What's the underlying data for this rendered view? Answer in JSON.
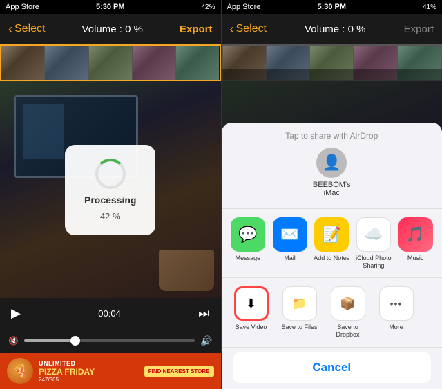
{
  "left_panel": {
    "status_bar": {
      "carrier": "App Store",
      "signal": "●●●●",
      "wifi": "wifi",
      "time": "5:30 PM",
      "battery": "42%"
    },
    "nav": {
      "back_label": "Select",
      "title": "Volume : 0 %",
      "export_label": "Export"
    },
    "processing": {
      "label": "Processing",
      "percent": "42 %"
    },
    "playback": {
      "time": "00:04"
    },
    "ad": {
      "line1": "UNLIMITED",
      "line2": "PIZZA FRIDAY",
      "line3": "247/365",
      "cta": "FIND NEAREST STORE"
    }
  },
  "right_panel": {
    "status_bar": {
      "carrier": "App Store",
      "signal": "●●●●",
      "wifi": "wifi",
      "time": "5:30 PM",
      "battery": "41%"
    },
    "nav": {
      "back_label": "Select",
      "title": "Volume : 0 %",
      "export_label": "Export"
    },
    "share_sheet": {
      "airdrop_label": "Tap to share with AirDrop",
      "device_name": "BEEBOM's\niMac",
      "apps": [
        {
          "name": "Message",
          "icon": "💬",
          "bg_class": "app-icon-message"
        },
        {
          "name": "Mail",
          "icon": "✉️",
          "bg_class": "app-icon-mail"
        },
        {
          "name": "Add to Notes",
          "icon": "📝",
          "bg_class": "app-icon-notes"
        },
        {
          "name": "iCloud Photo Sharing",
          "icon": "☁️",
          "bg_class": "app-icon-icloud"
        },
        {
          "name": "Music",
          "icon": "🎵",
          "bg_class": "app-icon-music"
        }
      ],
      "actions": [
        {
          "name": "Save Video",
          "icon": "⬇",
          "highlighted": true
        },
        {
          "name": "Save to Files",
          "icon": "📁",
          "highlighted": false
        },
        {
          "name": "Save to Dropbox",
          "icon": "📦",
          "highlighted": false
        },
        {
          "name": "More",
          "icon": "•••",
          "highlighted": false
        }
      ],
      "cancel_label": "Cancel"
    }
  }
}
